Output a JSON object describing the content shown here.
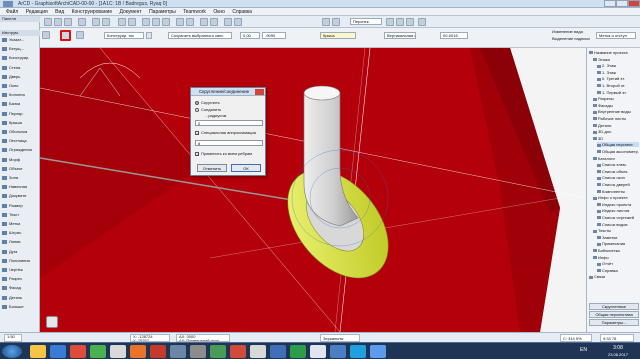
{
  "window": {
    "title": "ArCD - GraphisoftArchiCAD-00-00 - [1A1C: 1B / Badregus, Ryaq 0]"
  },
  "menubar": {
    "items": [
      "Файл",
      "Редакция",
      "Вид",
      "Конструирование",
      "Документ",
      "Параметры",
      "Teamwork",
      "Окно",
      "Справка"
    ]
  },
  "toolbar": {
    "layer_field": "Конструир. ткс",
    "save_selection": "Сохранить выбранного канс",
    "coord_x": "0,00",
    "coord_y": "-9090",
    "material_field": "Крыса",
    "view_field": "Вертикальная сист.",
    "view_value": "00-0016",
    "perspective_label": "Перспек.",
    "right_label_1": "Изменение вида",
    "right_label_2": "Выделение надписи",
    "right_button": "Метка и отступ"
  },
  "left_panel": {
    "header": "Панели",
    "section1": "Инструм.",
    "items": [
      "Указат...",
      "Бегущ...",
      "Конструир.",
      "Стена",
      "Дверь",
      "Окно",
      "Колонна",
      "Балка",
      "Перекр.",
      "Крыша",
      "Оболочка",
      "Лестница",
      "Ограждения",
      "Морф",
      "Объект",
      "Зона",
      "Навесная",
      "Документ",
      "Размер",
      "Текст",
      "Метка",
      "Штрих.",
      "Линия",
      "Дуга",
      "Полилиния",
      "Чертёж",
      "Разрез",
      "Фасад",
      "Деталь",
      "Больше"
    ]
  },
  "dialog": {
    "title": "Скругление/соединение",
    "option_fillet": "Скруглить",
    "option_chamfer": "Соединить",
    "radius_label": "...радиусом",
    "radius_value": "0",
    "segments_label": "Специальная аппроксимация",
    "segments_value": "8",
    "apply_all_label": "Применить ко всем ребрам",
    "cancel_button": "Отменить",
    "ok_button": "ОК"
  },
  "right_panel": {
    "items": [
      "Название проекта",
      "Этажи",
      "2. Этаж",
      "1. Этаж",
      "0. Третий эт.",
      "1. Второй эт.",
      "1. Первый эт.",
      "Разрезы",
      "Фасады",
      "Внутренние виды",
      "Рабочие листы",
      "Детали",
      "3D-док.",
      "3D",
      "Общая перспект.",
      "Общая аксонометр.",
      "Каталоги",
      "Список элем.",
      "Список объек.",
      "Список окон",
      "Список дверей",
      "Компоненты",
      "Инфо о проекте",
      "Индекс проекта",
      "Индекс листов",
      "Список чертежей",
      "Список видов",
      "Тексты",
      "Заметки",
      "Примечания",
      "Библиотека",
      "Инфо",
      "Отчёт",
      "Справка",
      "Связи"
    ],
    "button1": "Скругленные",
    "button2": "Общая перспектива",
    "button3": "Параметры..."
  },
  "statusbar": {
    "scale": "1:50",
    "coords": "X: -128724\nY: 75257",
    "delta": "ΔX: 0000\nΔY: Примечений исчо",
    "status_text": "Зеркальны",
    "zoom": "С: 314 5%",
    "angle": "9:33 78"
  },
  "taskbar": {
    "lang": "EN",
    "time": "3:08",
    "date": "23.06.2017"
  },
  "colors": {
    "model_red": "#b3000a",
    "model_dark_red": "#7d0007",
    "ring_yellow": "#e2f03a",
    "cylinder_grey": "#d7d7d7",
    "selection_blue": "#2a6fd0"
  }
}
